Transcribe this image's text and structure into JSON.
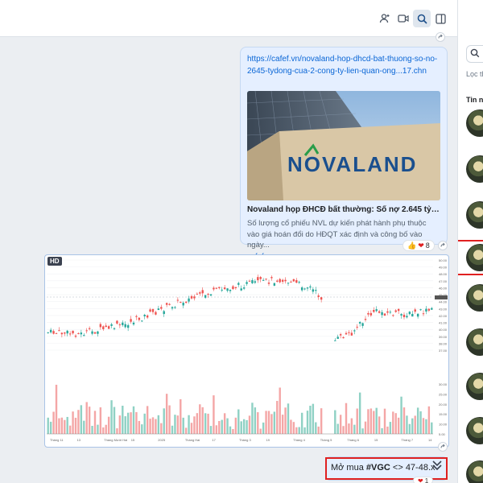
{
  "topbar": {
    "icons": [
      "add-person-icon",
      "video-call-icon",
      "search-icon",
      "toggle-panel-icon"
    ]
  },
  "right_panel": {
    "filter_text": "Lọc th",
    "section_label": "Tin nh"
  },
  "messages": [
    {
      "type": "link",
      "url": "https://cafef.vn/novaland-hop-dhcd-bat-thuong-so-no-2645-tydong-cua-2-cong-ty-lien-quan-ong...17.chn",
      "title": "Novaland họp ĐHCĐ bất thường: Số nợ 2.645 tỷ đồng...",
      "description": "Số lượng cổ phiếu NVL dự kiến phát hành phụ thuộc vào giá hoán đổi do HĐQT xác định và công bố vào ngày...",
      "domain": "cafef.vn",
      "preview_brand": "NOVALAND",
      "reaction_count": "8"
    },
    {
      "type": "image",
      "badge": "HD"
    },
    {
      "type": "text",
      "prefix": "Mở mua ",
      "hashtag": "#VGC",
      "suffix": " <> 47-48.x",
      "reaction_count": "1"
    }
  ],
  "chart_data": {
    "type": "candlestick",
    "bars": 140,
    "price_ticks": [
      "50.00",
      "49.00",
      "48.00",
      "47.00",
      "46.00",
      "45.00",
      "44.00",
      "43.00",
      "42.00",
      "41.00",
      "40.00",
      "39.00",
      "38.00",
      "37.00"
    ],
    "volume_ticks": [
      "30.00",
      "25.00",
      "20.00",
      "15.00",
      "10.00",
      "5.00"
    ],
    "x_ticks": [
      "Tháng 11",
      "13",
      "Tháng Mười Hai",
      "15",
      "2025",
      "Tháng Hai",
      "17",
      "Tháng 3",
      "19",
      "Tháng 4",
      "Tháng 5",
      "Tháng 6",
      "15",
      "Tháng 7",
      "14"
    ],
    "colors": {
      "up": "#26a69a",
      "down": "#ef5350",
      "up_vol": "#8fd1c4",
      "down_vol": "#f4a6a6"
    }
  }
}
